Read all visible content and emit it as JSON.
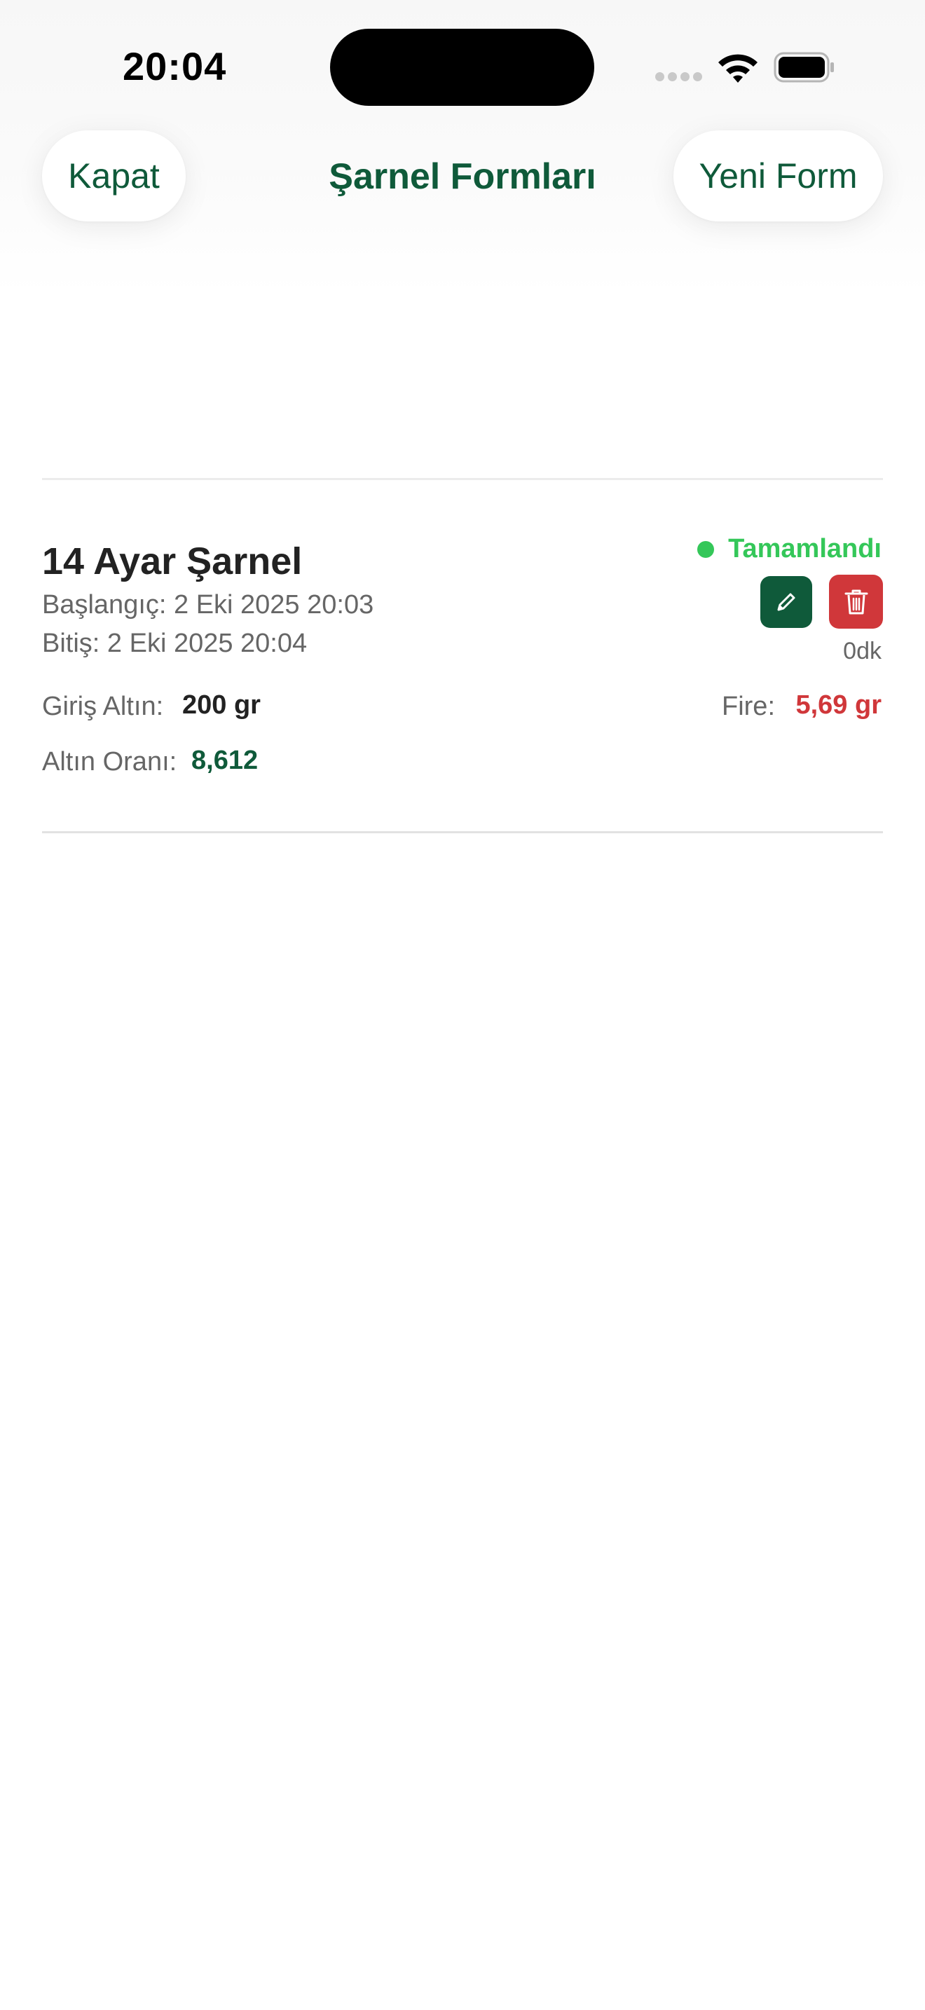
{
  "status_bar": {
    "time": "20:04"
  },
  "nav": {
    "close_label": "Kapat",
    "title": "Şarnel Formları",
    "new_label": "Yeni Form"
  },
  "form_card": {
    "title": "14 Ayar Şarnel",
    "start": "Başlangıç: 2 Eki 2025 20:03",
    "end": "Bitiş: 2 Eki 2025 20:04",
    "status": "Tamamlandı",
    "duration": "0dk",
    "giris_label": "Giriş Altın:",
    "giris_value": "200 gr",
    "fire_label": "Fire:",
    "fire_value": "5,69 gr",
    "oran_label": "Altın Oranı:",
    "oran_value": "8,612",
    "edit_icon": "pencil-icon",
    "delete_icon": "trash-icon"
  },
  "colors": {
    "brand_green": "#0f5a3a",
    "status_green": "#34c759",
    "danger_red": "#d0373a",
    "text_primary": "#222222",
    "text_secondary": "#666666"
  }
}
